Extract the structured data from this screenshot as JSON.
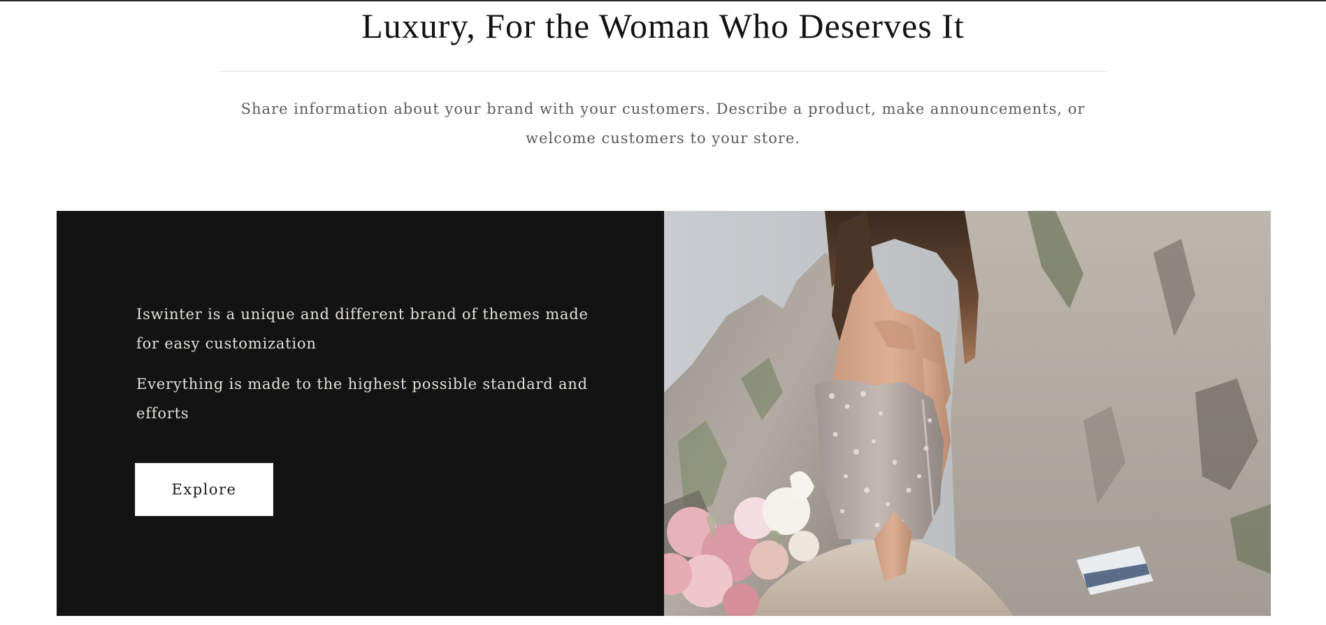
{
  "section": {
    "heading": "Luxury, For the Woman Who Deserves It",
    "intro": "Share information about your brand with your customers. Describe a product, make announcements, or welcome customers to your store."
  },
  "banner": {
    "paragraph_1": "Iswinter is a unique and different brand of themes made for easy customization",
    "paragraph_2": "Everything is made to the highest possible standard and efforts",
    "button_label": "Explore",
    "image": {
      "subject": "bride-in-strapless-beaded-gown-holding-pink-bouquet-by-cliffs"
    }
  },
  "colors": {
    "panel_background": "#131313",
    "panel_text": "#e3e0da",
    "heading_text": "#121212",
    "intro_text": "#5a5a5a",
    "button_background": "#ffffff"
  }
}
